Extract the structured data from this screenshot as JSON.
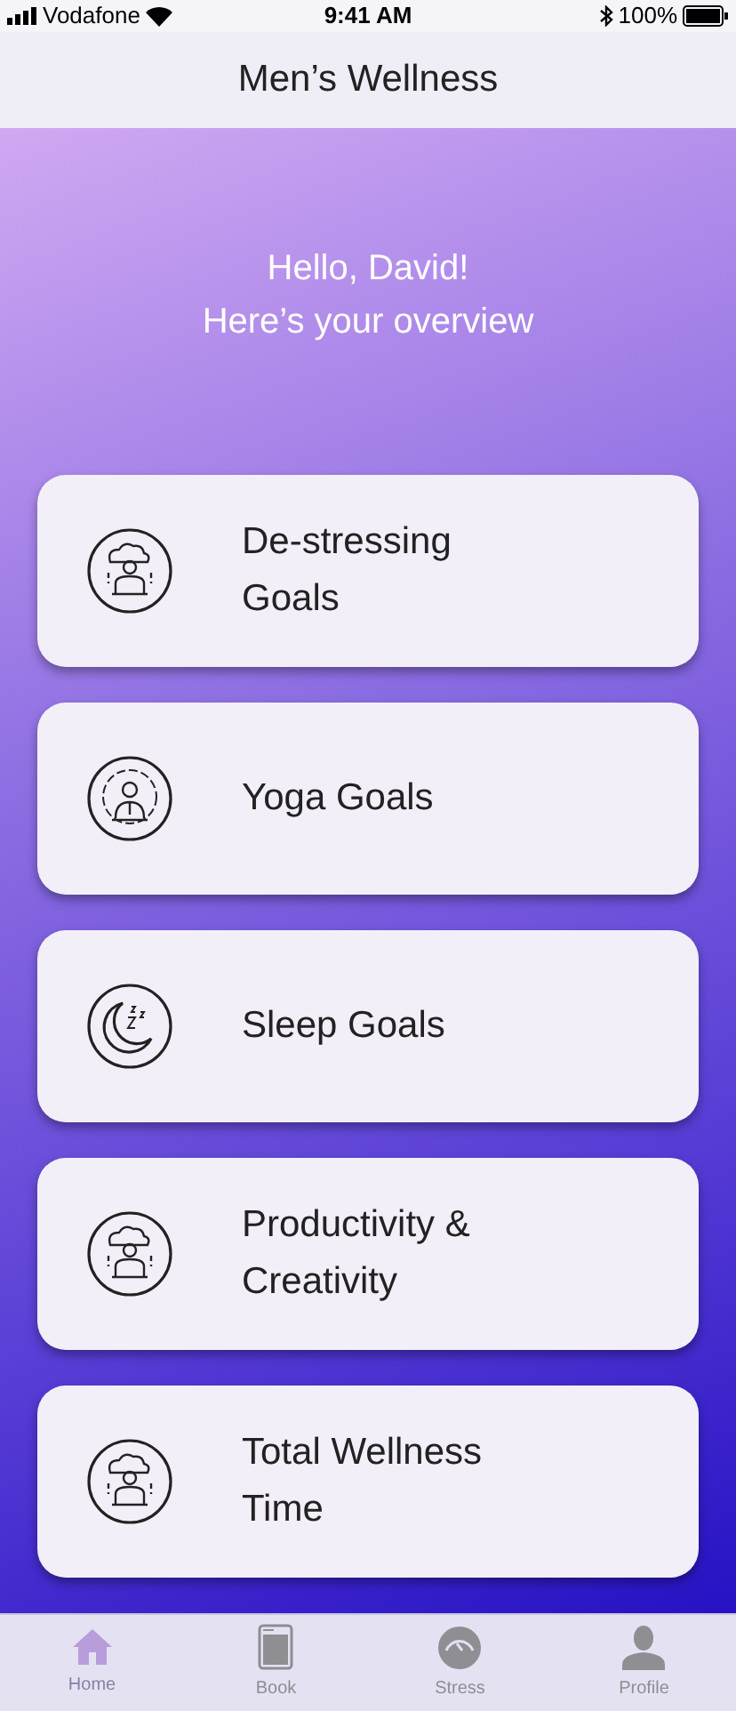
{
  "status_bar": {
    "carrier": "Vodafone",
    "time": "9:41 AM",
    "battery": "100%"
  },
  "header": {
    "title": "Men’s Wellness"
  },
  "greeting": [
    "Hello, David!",
    "Here’s your overview"
  ],
  "goals": [
    {
      "label": "De-stressing Goals",
      "kind": "stress"
    },
    {
      "label": "Yoga Goals",
      "kind": "yoga"
    },
    {
      "label": "Sleep Goals",
      "kind": "sleep"
    },
    {
      "label": "Productivity & Creativity",
      "kind": "stress"
    },
    {
      "label": "Total Wellness Time",
      "kind": "stress"
    }
  ],
  "tabs": [
    {
      "label": "Home",
      "kind": "home",
      "selected": true
    },
    {
      "label": "Book",
      "kind": "book",
      "selected": false
    },
    {
      "label": "Stress",
      "kind": "gauge",
      "selected": false
    },
    {
      "label": "Profile",
      "kind": "person",
      "selected": false
    }
  ]
}
